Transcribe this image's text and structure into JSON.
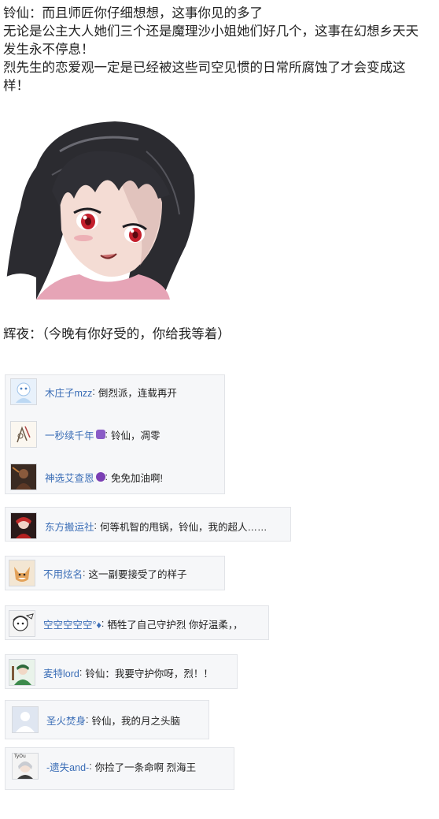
{
  "post": {
    "lines": [
      "铃仙：而且师匠你仔细想想，这事你见的多了",
      "无论是公主大人她们三个还是魔理沙小姐她们好几个，这事在幻想乡天天",
      "发生永不停息！",
      "烈先生的恋爱观一定是已经被这些司空见惯的日常所腐蚀了才会变成这",
      "样！"
    ],
    "speaker_line": "辉夜：（今晚有你好受的，你给我等着）"
  },
  "comments": {
    "group1": [
      {
        "user": "木庄子mzz",
        "text": "倒烈派，连载再开",
        "avatar": "white-fairy-avatar"
      },
      {
        "user": "一秒续千年",
        "badge": "purple-badge",
        "text": "铃仙，凋零",
        "avatar": "sketch-avatar"
      },
      {
        "user": "神选艾查恩",
        "badge": "devil-emoji",
        "text": "免免加油啊!",
        "avatar": "dark-figure-avatar"
      }
    ],
    "c4": {
      "user": "东方搬运社",
      "text": "何等机智的甩锅，铃仙，我的超人……",
      "avatar": "red-character-avatar"
    },
    "c5": {
      "user": "不用炫名",
      "text": "这一副要接受了的样子",
      "avatar": "fox-avatar"
    },
    "c6": {
      "user": "空空空空空°♦",
      "text": "牺牲了自己守护烈 你好温柔，，",
      "avatar": "manga-face-avatar"
    },
    "c7": {
      "user": "麦特lord",
      "text": "铃仙：我要守护你呀，烈！！",
      "avatar": "green-character-avatar"
    },
    "c8": {
      "user": "圣火焚身",
      "text": "铃仙，我的月之头脑",
      "avatar": "default-user-avatar"
    },
    "c9": {
      "user": "-遗失and-",
      "text": "你捡了一条命啊 烈海王",
      "avatar": "silver-hair-avatar",
      "avatar_text": "TyOu"
    }
  },
  "colors": {
    "username": "#3a6db6",
    "comment_bg": "#f6f7f9",
    "comment_border": "#e2e4e8",
    "badge_purple": "#8a5cc7",
    "badge_devil": "#7b3fb4"
  }
}
